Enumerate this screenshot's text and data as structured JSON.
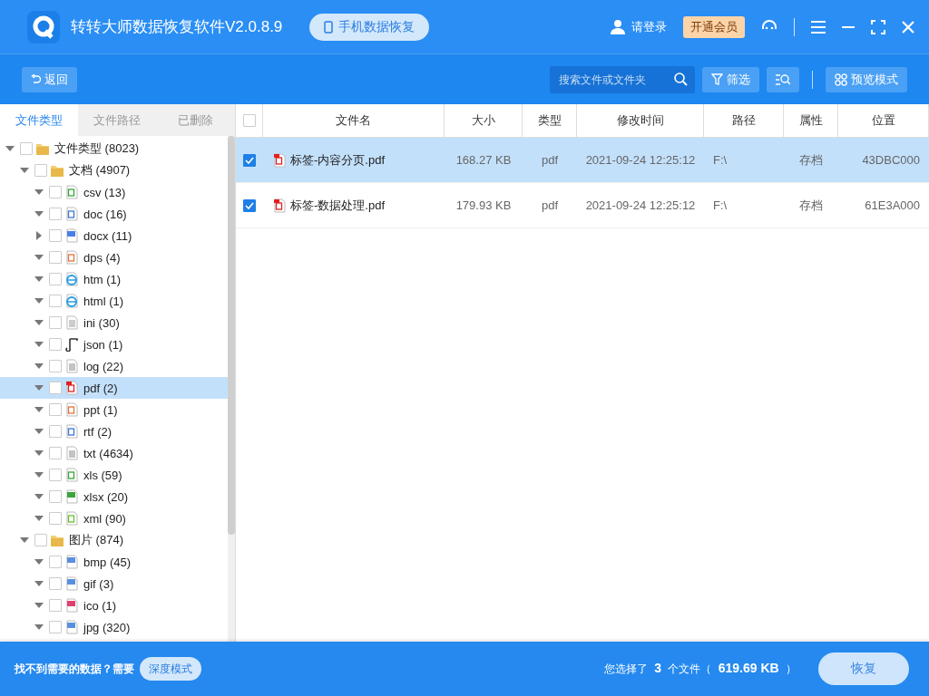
{
  "window": {
    "title": "转转大师数据恢复软件V2.0.8.9",
    "mode_button": "手机数据恢复",
    "login": "请登录",
    "vip": "开通会员"
  },
  "toolbar": {
    "back": "返回",
    "search": {
      "placeholder": "搜索文件或文件夹"
    },
    "filter": "筛选",
    "preview": "预览模式"
  },
  "sidebar": {
    "tabs": [
      {
        "label": "文件类型",
        "selected": true
      },
      {
        "label": "文件路径",
        "selected": false
      },
      {
        "label": "已删除",
        "selected": false
      }
    ],
    "tree": [
      {
        "label": "文件类型 (8023)",
        "kind": "folder",
        "expanded": true,
        "checked": false,
        "selected": false,
        "children": [
          {
            "label": "文档 (4907)",
            "kind": "folder",
            "expanded": true,
            "checked": false,
            "selected": false,
            "children": [
              {
                "label": "csv (13)",
                "kind": "sheet",
                "expanded": true,
                "checked": false,
                "selected": false
              },
              {
                "label": "doc (16)",
                "kind": "word",
                "expanded": true,
                "checked": false,
                "selected": false
              },
              {
                "label": "docx (11)",
                "kind": "wordfill",
                "expanded": false,
                "checked": false,
                "selected": false
              },
              {
                "label": "dps (4)",
                "kind": "slides",
                "expanded": true,
                "checked": false,
                "selected": false
              },
              {
                "label": "htm (1)",
                "kind": "web",
                "expanded": true,
                "checked": false,
                "selected": false
              },
              {
                "label": "html (1)",
                "kind": "web",
                "expanded": true,
                "checked": false,
                "selected": false
              },
              {
                "label": "ini (30)",
                "kind": "settings",
                "expanded": true,
                "checked": false,
                "selected": false
              },
              {
                "label": "json (1)",
                "kind": "script",
                "expanded": true,
                "checked": false,
                "selected": false
              },
              {
                "label": "log (22)",
                "kind": "text",
                "expanded": true,
                "checked": false,
                "selected": false
              },
              {
                "label": "pdf (2)",
                "kind": "pdf",
                "expanded": true,
                "checked": false,
                "selected": true
              },
              {
                "label": "ppt (1)",
                "kind": "slides",
                "expanded": true,
                "checked": false,
                "selected": false
              },
              {
                "label": "rtf (2)",
                "kind": "word",
                "expanded": true,
                "checked": false,
                "selected": false
              },
              {
                "label": "txt (4634)",
                "kind": "text",
                "expanded": true,
                "checked": false,
                "selected": false
              },
              {
                "label": "xls (59)",
                "kind": "sheet",
                "expanded": true,
                "checked": false,
                "selected": false
              },
              {
                "label": "xlsx (20)",
                "kind": "sheetfill",
                "expanded": true,
                "checked": false,
                "selected": false
              },
              {
                "label": "xml (90)",
                "kind": "xml",
                "expanded": true,
                "checked": false,
                "selected": false
              }
            ]
          },
          {
            "label": "图片 (874)",
            "kind": "folder",
            "expanded": true,
            "checked": false,
            "selected": false,
            "children": [
              {
                "label": "bmp (45)",
                "kind": "image",
                "expanded": true,
                "checked": false,
                "selected": false
              },
              {
                "label": "gif (3)",
                "kind": "image",
                "expanded": true,
                "checked": false,
                "selected": false
              },
              {
                "label": "ico (1)",
                "kind": "imagered",
                "expanded": true,
                "checked": false,
                "selected": false
              },
              {
                "label": "jpg (320)",
                "kind": "image",
                "expanded": true,
                "checked": false,
                "selected": false
              }
            ]
          }
        ]
      }
    ]
  },
  "table": {
    "select_all": false,
    "columns": [
      "文件名",
      "大小",
      "类型",
      "修改时间",
      "路径",
      "属性",
      "位置"
    ],
    "rows": [
      {
        "checked": true,
        "selected": true,
        "cells": [
          "标签-内容分页.pdf",
          "168.27 KB",
          "pdf",
          "2021-09-24 12:25:12",
          "F:\\",
          "存档",
          "43DBC000"
        ]
      },
      {
        "checked": true,
        "selected": false,
        "cells": [
          "标签-数据处理.pdf",
          "179.93 KB",
          "pdf",
          "2021-09-24 12:25:12",
          "F:\\",
          "存档",
          "61E3A000"
        ]
      }
    ]
  },
  "footer": {
    "hint": "找不到需要的数据？需要",
    "deep_mode": "深度模式",
    "summary": "您选择了 **3** 个文件（ **619.69 KB** ）",
    "recover": "恢复"
  }
}
